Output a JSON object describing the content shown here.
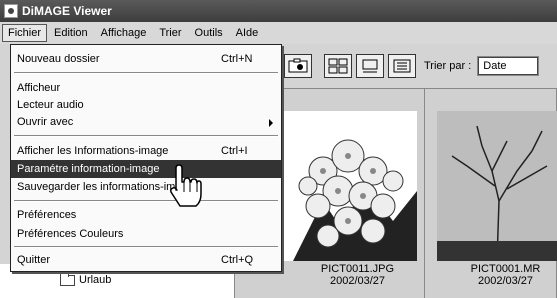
{
  "window": {
    "title": "DiMAGE Viewer"
  },
  "menubar": {
    "items": [
      {
        "label": "Fichier",
        "active": true
      },
      {
        "label": "Edition"
      },
      {
        "label": "Affichage"
      },
      {
        "label": "Trier"
      },
      {
        "label": "Outils"
      },
      {
        "label": "AIde"
      }
    ]
  },
  "file_menu": {
    "items": [
      {
        "label": "Nouveau dossier",
        "shortcut": "Ctrl+N"
      },
      {
        "label": "Afficheur",
        "shortcut": ""
      },
      {
        "label": "Lecteur audio",
        "shortcut": ""
      },
      {
        "label": "Ouvrir avec",
        "shortcut": "",
        "submenu": true
      },
      {
        "label": "Afficher les Informations-image",
        "shortcut": "Ctrl+I"
      },
      {
        "label": "Paramétre information-image",
        "shortcut": "",
        "highlighted": true
      },
      {
        "label": "Sauvegarder les informations-image",
        "shortcut": ""
      },
      {
        "label": "Préférences",
        "shortcut": ""
      },
      {
        "label": "Préférences Couleurs",
        "shortcut": ""
      },
      {
        "label": "Quitter",
        "shortcut": "Ctrl+Q"
      }
    ]
  },
  "toolbar": {
    "sort_label": "Trier par :",
    "sort_value": "Date"
  },
  "gallery": {
    "items": [
      {
        "filename": "PICT0011.JPG",
        "date": "2002/03/27"
      },
      {
        "filename": "PICT0001.MR",
        "date": "2002/03/27"
      }
    ]
  },
  "tree": {
    "folder_label": "Urlaub"
  },
  "colors": {
    "titlebar": "#4a4a4a",
    "highlight": "#333333",
    "menu_bg": "#fafafa"
  }
}
